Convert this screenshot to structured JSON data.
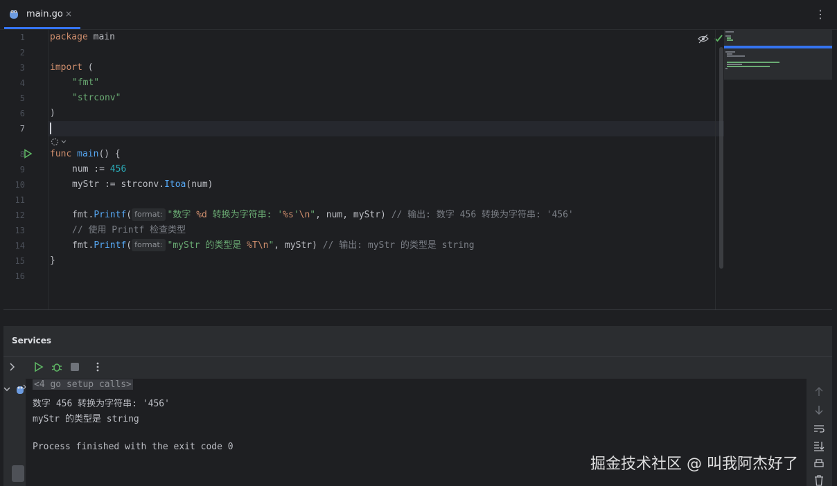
{
  "tab": {
    "label": "main.go",
    "close": "×",
    "more": "⋮"
  },
  "editor": {
    "line_numbers": [
      "1",
      "2",
      "3",
      "4",
      "5",
      "6",
      "7",
      "8",
      "9",
      "10",
      "11",
      "12",
      "13",
      "14",
      "15",
      "16"
    ],
    "current_line": "7",
    "lines": {
      "l1_kw": "package",
      "l1_rest": " main",
      "l3_kw": "import",
      "l3_rest": " (",
      "l4": "\"fmt\"",
      "l5": "\"strconv\"",
      "l6": ")",
      "l8_kw": "func",
      "l8_fn": "main",
      "l8_rest": "() {",
      "l9_a": "num := ",
      "l9_num": "456",
      "l10_a": "myStr := strconv.",
      "l10_fn": "Itoa",
      "l10_b": "(num)",
      "l12_a": "fmt.",
      "l12_fn": "Printf",
      "l12_b": "(",
      "l12_hint": "format:",
      "l12_str1": "\"数字 ",
      "l12_fmt1": "%d",
      "l12_str2": " 转换为字符串: '",
      "l12_fmt2": "%s",
      "l12_str3": "'",
      "l12_esc": "\\n",
      "l12_str4": "\"",
      "l12_args": ", num, myStr) ",
      "l12_cm": "// 输出: 数字 456 转换为字符串: '456'",
      "l13_cm": "// 使用 Printf 检查类型",
      "l14_a": "fmt.",
      "l14_fn": "Printf",
      "l14_b": "(",
      "l14_hint": "format:",
      "l14_str1": "\"myStr 的类型是 ",
      "l14_fmt1": "%T",
      "l14_esc": "\\n",
      "l14_str2": "\"",
      "l14_args": ", myStr) ",
      "l14_cm": "// 输出: myStr 的类型是 string",
      "l15": "}"
    }
  },
  "services": {
    "title": "Services",
    "console": {
      "setup_calls": "<4 go setup calls>",
      "out1": "数字 456 转换为字符串: '456'",
      "out2": "myStr 的类型是 string",
      "out3": "Process finished with the exit code 0"
    }
  },
  "watermark": "掘金技术社区 @ 叫我阿杰好了",
  "colors": {
    "accent": "#3574f0",
    "keyword": "#cf8e6d",
    "string": "#6aab73",
    "number": "#2aacb8",
    "function": "#56a8f5",
    "comment": "#7a7e85",
    "run_green": "#5fb865"
  }
}
